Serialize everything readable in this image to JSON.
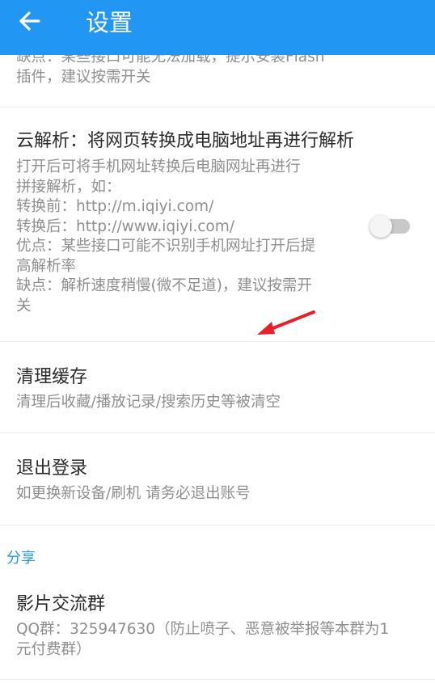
{
  "appbar": {
    "title": "设置",
    "back_icon": "arrow-left-icon",
    "color": "#2196f3"
  },
  "settings": {
    "flash_item_cut": {
      "desc_line1": "缺点：某些接口可能无法加载，提示安装Flash",
      "desc_line2": "插件，建议按需开关"
    },
    "cloud_parse": {
      "title": "云解析：将网页转换成电脑地址再进行解析",
      "desc_lines": [
        "打开后可将手机网址转换后电脑网址再进行",
        "拼接解析，如：",
        "转换前：http://m.iqiyi.com/",
        "转换后：http://www.iqiyi.com/",
        "优点：某些接口可能不识别手机网址打开后提",
        "高解析率",
        "缺点：解析速度稍慢(微不足道)，建议按需开",
        "关"
      ],
      "switch_on": false
    },
    "clear_cache": {
      "title": "清理缓存",
      "desc": "清理后收藏/播放记录/搜索历史等被清空"
    },
    "logout": {
      "title": "退出登录",
      "desc": "如更换新设备/刷机 请务必退出账号"
    }
  },
  "share_section": {
    "label": "分享",
    "group": {
      "title": "影片交流群",
      "desc_line1": "QQ群：325947630（防止喷子、恶意被举报等本群为1",
      "desc_line2": "元付费群）"
    }
  },
  "annotation": {
    "arrow_color": "#e8202a"
  }
}
